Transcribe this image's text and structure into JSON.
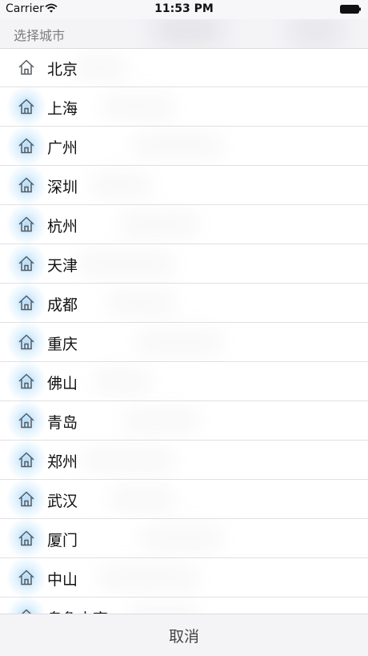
{
  "status_bar": {
    "carrier": "Carrier",
    "time": "11:53 PM",
    "wifi_icon": "wifi-icon",
    "battery_icon": "battery-icon"
  },
  "header": {
    "title": "选择城市"
  },
  "cities": [
    {
      "label": "北京",
      "icon": "home-icon"
    },
    {
      "label": "上海",
      "icon": "home-icon"
    },
    {
      "label": "广州",
      "icon": "home-icon"
    },
    {
      "label": "深圳",
      "icon": "home-icon"
    },
    {
      "label": "杭州",
      "icon": "home-icon"
    },
    {
      "label": "天津",
      "icon": "home-icon"
    },
    {
      "label": "成都",
      "icon": "home-icon"
    },
    {
      "label": "重庆",
      "icon": "home-icon"
    },
    {
      "label": "佛山",
      "icon": "home-icon"
    },
    {
      "label": "青岛",
      "icon": "home-icon"
    },
    {
      "label": "郑州",
      "icon": "home-icon"
    },
    {
      "label": "武汉",
      "icon": "home-icon"
    },
    {
      "label": "厦门",
      "icon": "home-icon"
    },
    {
      "label": "中山",
      "icon": "home-icon"
    },
    {
      "label": "乌鲁木齐",
      "icon": "home-icon"
    }
  ],
  "footer": {
    "cancel_label": "取消"
  },
  "colors": {
    "icon_stroke": "#555a60",
    "highlight": "#74c0f8",
    "separator": "#e1e1e6"
  }
}
